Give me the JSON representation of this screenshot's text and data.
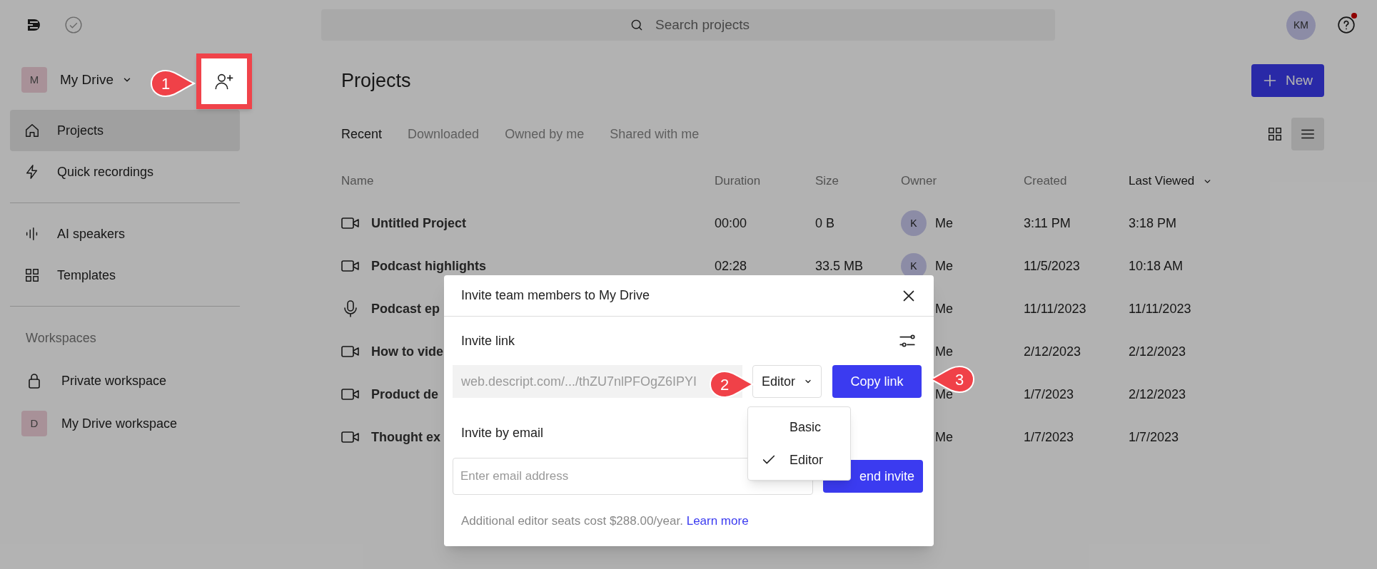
{
  "header": {
    "search": {
      "placeholder": "Search projects"
    },
    "avatar": "KM",
    "help_notification": true
  },
  "sidebar": {
    "drive": {
      "initial": "M",
      "name": "My Drive"
    },
    "nav": [
      {
        "kind": "home",
        "label": "Projects",
        "selected": true
      },
      {
        "kind": "bolt",
        "label": "Quick recordings",
        "selected": false
      }
    ],
    "tools": [
      {
        "kind": "wave",
        "label": "AI speakers",
        "selected": false
      },
      {
        "kind": "grid",
        "label": "Templates",
        "selected": false
      }
    ],
    "workspaces_heading": "Workspaces",
    "workspaces": [
      {
        "kind": "lock",
        "label": "Private workspace"
      },
      {
        "kind": "avatar",
        "initial": "D",
        "label": "My Drive workspace"
      }
    ]
  },
  "main": {
    "title": "Projects",
    "new_button": "New",
    "tabs": [
      {
        "label": "Recent",
        "selected": true
      },
      {
        "label": "Downloaded",
        "selected": false
      },
      {
        "label": "Owned by me",
        "selected": false
      },
      {
        "label": "Shared with me",
        "selected": false
      }
    ],
    "view": [
      {
        "kind": "grid",
        "selected": false
      },
      {
        "kind": "list",
        "selected": true
      }
    ],
    "table": {
      "columns": [
        {
          "label": "Name",
          "sorted": false
        },
        {
          "label": "Duration",
          "sorted": false
        },
        {
          "label": "Size",
          "sorted": false
        },
        {
          "label": "Owner",
          "sorted": false
        },
        {
          "label": "Created",
          "sorted": false
        },
        {
          "label": "Last Viewed",
          "sorted": true
        }
      ],
      "rows": [
        {
          "kind": "video",
          "name": "Untitled Project",
          "duration": "00:00",
          "size": "0 B",
          "owner_initial": "K",
          "owner": "Me",
          "created": "3:11 PM",
          "last_viewed": "3:18 PM"
        },
        {
          "kind": "video",
          "name": "Podcast highlights",
          "duration": "02:28",
          "size": "33.5 MB",
          "owner_initial": "K",
          "owner": "Me",
          "created": "11/5/2023",
          "last_viewed": "10:18 AM"
        },
        {
          "kind": "mic",
          "name": "Podcast ep",
          "owner": "Me",
          "created": "11/11/2023",
          "last_viewed": "11/11/2023"
        },
        {
          "kind": "video",
          "name": "How to vide",
          "owner": "Me",
          "created": "2/12/2023",
          "last_viewed": "2/12/2023"
        },
        {
          "kind": "video",
          "name": "Product de",
          "owner": "Me",
          "created": "1/7/2023",
          "last_viewed": "2/12/2023"
        },
        {
          "kind": "video",
          "name": "Thought ex",
          "owner": "Me",
          "created": "1/7/2023",
          "last_viewed": "1/7/2023"
        }
      ]
    }
  },
  "dialog": {
    "title": "Invite team members to My Drive",
    "link_heading": "Invite link",
    "link": "web.descript.com/.../thZU7nlPFOgZ6IPYI",
    "link_role": "Editor",
    "copy_button": "Copy link",
    "email_heading": "Invite by email",
    "email": {
      "placeholder": "Enter email address"
    },
    "send_button": "end invite",
    "note": "Additional editor seats cost $288.00/year.",
    "note_link": "Learn more",
    "menu": [
      {
        "label": "Basic",
        "selected": false
      },
      {
        "label": "Editor",
        "selected": true
      }
    ]
  },
  "callouts": [
    "1",
    "2",
    "3"
  ]
}
